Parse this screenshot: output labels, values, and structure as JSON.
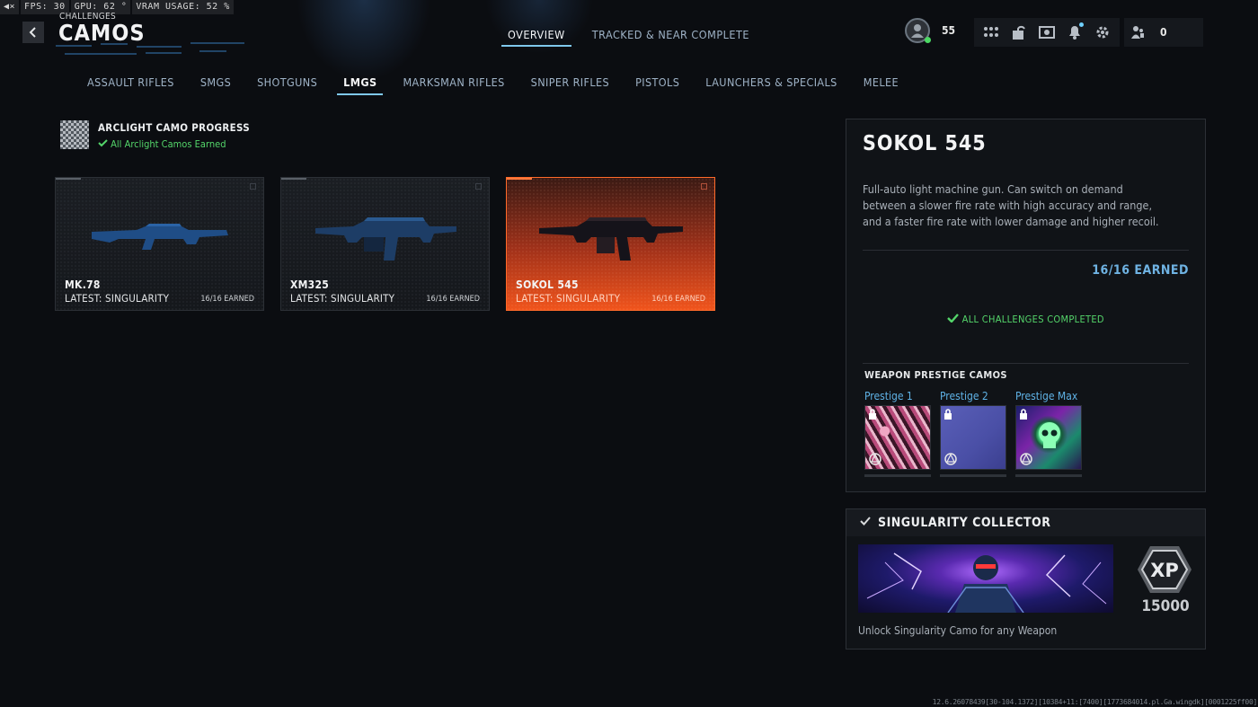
{
  "perf": {
    "fps": "FPS:  30",
    "gpu": "GPU: 62 °",
    "vram": "VRAM USAGE: 52 %"
  },
  "header": {
    "breadcrumb": "CHALLENGES",
    "title": "CAMOS",
    "tabs": [
      {
        "label": "OVERVIEW",
        "active": true
      },
      {
        "label": "TRACKED & NEAR COMPLETE",
        "active": false
      }
    ],
    "player_level": "55",
    "friends_count": "0"
  },
  "categories": [
    {
      "label": "ASSAULT RIFLES",
      "active": false
    },
    {
      "label": "SMGS",
      "active": false
    },
    {
      "label": "SHOTGUNS",
      "active": false
    },
    {
      "label": "LMGS",
      "active": true
    },
    {
      "label": "MARKSMAN RIFLES",
      "active": false
    },
    {
      "label": "SNIPER RIFLES",
      "active": false
    },
    {
      "label": "PISTOLS",
      "active": false
    },
    {
      "label": "LAUNCHERS & SPECIALS",
      "active": false
    },
    {
      "label": "MELEE",
      "active": false
    }
  ],
  "arclight": {
    "title": "ARCLIGHT CAMO PROGRESS",
    "status": "All Arclight Camos Earned"
  },
  "weapons": [
    {
      "name": "MK.78",
      "latest": "LATEST: SINGULARITY",
      "earned": "16/16 EARNED",
      "selected": false
    },
    {
      "name": "XM325",
      "latest": "LATEST: SINGULARITY",
      "earned": "16/16 EARNED",
      "selected": false
    },
    {
      "name": "SOKOL 545",
      "latest": "LATEST: SINGULARITY",
      "earned": "16/16 EARNED",
      "selected": true
    }
  ],
  "detail": {
    "name": "SOKOL 545",
    "description": "Full-auto light machine gun. Can switch on demand between a slower fire rate with high accuracy and range, and a faster fire rate with lower damage and higher recoil.",
    "earned": "16/16 EARNED",
    "complete": "ALL CHALLENGES COMPLETED",
    "prestige_heading": "WEAPON PRESTIGE CAMOS",
    "prestige": [
      {
        "label": "Prestige 1"
      },
      {
        "label": "Prestige 2"
      },
      {
        "label": "Prestige Max"
      }
    ]
  },
  "collector": {
    "title": "SINGULARITY COLLECTOR",
    "xp_badge": "XP",
    "xp": "15000",
    "description": "Unlock Singularity Camo for any Weapon"
  },
  "build": "12.6.26078439[30-104.1372][10384+11:[7400][1773684014.pl.Ga.wingdk][0001225ff00]",
  "colors": {
    "accent": "#7fc8ec",
    "selected": "#f0541c",
    "success": "#54d56a",
    "earned": "#6fb3e3"
  }
}
